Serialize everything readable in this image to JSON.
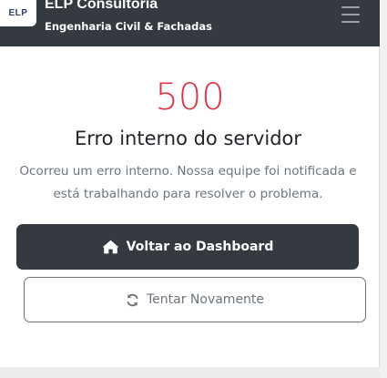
{
  "navbar": {
    "logo_text": "ELP",
    "brand_title": "ELP Consultoria",
    "brand_subtitle": "Engenharia Civil & Fachadas",
    "menu_icon": "hamburger-menu-icon"
  },
  "error": {
    "code": "500",
    "title": "Erro interno do servidor",
    "message": "Ocorreu um erro interno. Nossa equipe foi notificada e está trabalhando para resolver o problema."
  },
  "actions": {
    "dashboard_label": "Voltar ao Dashboard",
    "dashboard_icon": "home-icon",
    "retry_label": "Tentar Novamente",
    "retry_icon": "refresh-icon"
  },
  "colors": {
    "navbar_bg": "#343a40",
    "error_code": "#dc3545",
    "primary_button": "#343a40",
    "secondary_text": "#6c757d"
  }
}
